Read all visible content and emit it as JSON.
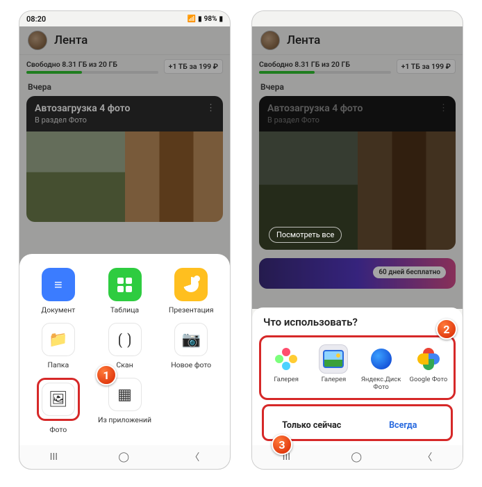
{
  "statusbar": {
    "time": "08:20",
    "battery": "98%"
  },
  "header": {
    "title": "Лента"
  },
  "storage": {
    "text": "Свободно 8.31 ГБ из 20 ГБ",
    "upsell": "+1 ТБ за 199 ₽"
  },
  "section": {
    "yesterday": "Вчера"
  },
  "card": {
    "title": "Автозагрузка 4 фото",
    "subtitle": "В раздел Фото",
    "see_all": "Посмотреть все"
  },
  "promo": {
    "badge": "60 дней бесплатно"
  },
  "create_sheet": {
    "row1": [
      {
        "key": "document",
        "label": "Документ"
      },
      {
        "key": "table",
        "label": "Таблица"
      },
      {
        "key": "presentation",
        "label": "Презентация"
      }
    ],
    "row2": [
      {
        "key": "folder",
        "label": "Папка"
      },
      {
        "key": "scan",
        "label": "Скан"
      },
      {
        "key": "new_photo",
        "label": "Новое фото"
      }
    ],
    "row3": [
      {
        "key": "photo",
        "label": "Фото"
      },
      {
        "key": "from_apps",
        "label": "Из приложений"
      }
    ]
  },
  "chooser": {
    "title": "Что использовать?",
    "apps": [
      {
        "key": "gallery1",
        "label": "Галерея"
      },
      {
        "key": "gallery2",
        "label": "Галерея"
      },
      {
        "key": "yadisk",
        "label": "Яндекс.Диск Фото"
      },
      {
        "key": "gphotos",
        "label": "Google Фото"
      }
    ],
    "once": "Только сейчас",
    "always": "Всегда"
  },
  "badges": {
    "b1": "1",
    "b2": "2",
    "b3": "3"
  }
}
